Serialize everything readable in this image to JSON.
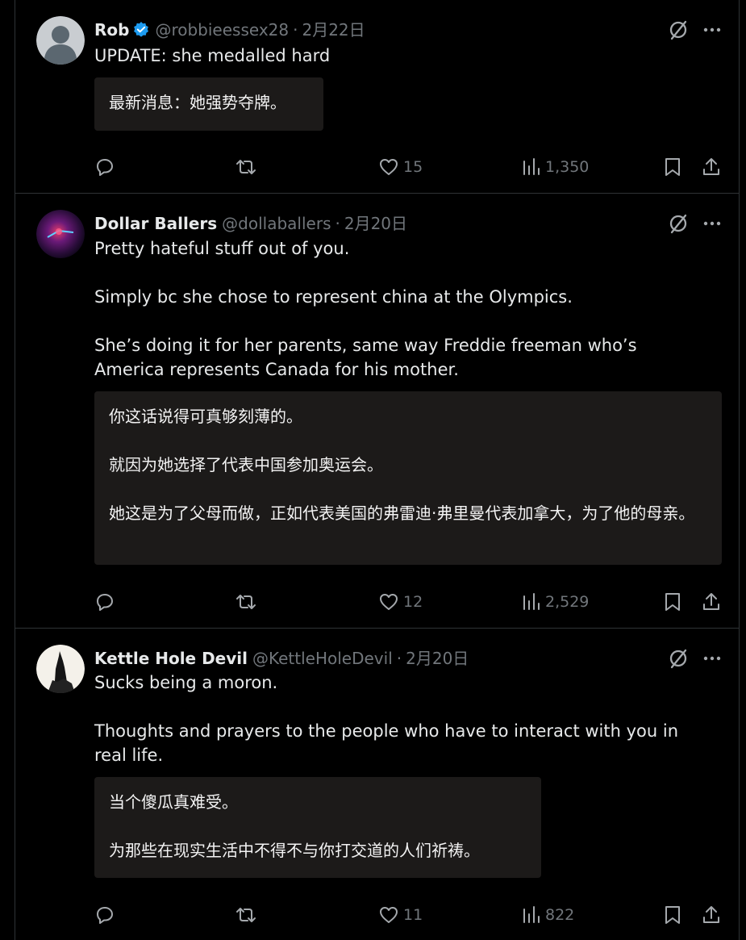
{
  "tweets": [
    {
      "name": "Rob",
      "verified": true,
      "handle": "@robbieessex28",
      "dot": "·",
      "date": "2月22日",
      "paragraphs": [
        "UPDATE: she medalled hard"
      ],
      "translation": [
        "最新消息：她强势夺牌。"
      ],
      "replies": "",
      "retweets": "",
      "likes": "15",
      "views": "1,350",
      "avatar": "default-person-avatar"
    },
    {
      "name": "Dollar Ballers",
      "verified": false,
      "handle": "@dollaballers",
      "dot": "·",
      "date": "2月20日",
      "paragraphs": [
        "Pretty hateful stuff out of you.",
        "Simply bc she chose to represent china at the Olympics.",
        "She’s doing it for her parents, same way Freddie freeman who’s America represents Canada for his mother."
      ],
      "translation": [
        "你这话说得可真够刻薄的。",
        "就因为她选择了代表中国参加奥运会。",
        "她这是为了父母而做，正如代表美国的弗雷迪·弗里曼代表加拿大，为了他的母亲。"
      ],
      "replies": "",
      "retweets": "",
      "likes": "12",
      "views": "2,529",
      "avatar": "purple-light-avatar"
    },
    {
      "name": "Kettle Hole Devil",
      "verified": false,
      "handle": "@KettleHoleDevil",
      "dot": "·",
      "date": "2月20日",
      "paragraphs": [
        "Sucks being a moron.",
        "Thoughts and prayers to the people who have to interact with you in real life."
      ],
      "translation": [
        "当个傻瓜真难受。",
        "为那些在现实生活中不得不与你打交道的人们祈祷。"
      ],
      "replies": "",
      "retweets": "",
      "likes": "11",
      "views": "822",
      "avatar": "silhouette-tower-avatar"
    }
  ],
  "colors": {
    "background": "#000000",
    "text": "#e7e9ea",
    "muted": "#71767b",
    "divider": "#2f3336",
    "verified": "#1d9bf0",
    "translation_bg": "#1c1a19"
  },
  "icons": [
    "grok-icon",
    "more-icon",
    "reply-icon",
    "retweet-icon",
    "like-icon",
    "views-icon",
    "bookmark-icon",
    "share-icon"
  ]
}
